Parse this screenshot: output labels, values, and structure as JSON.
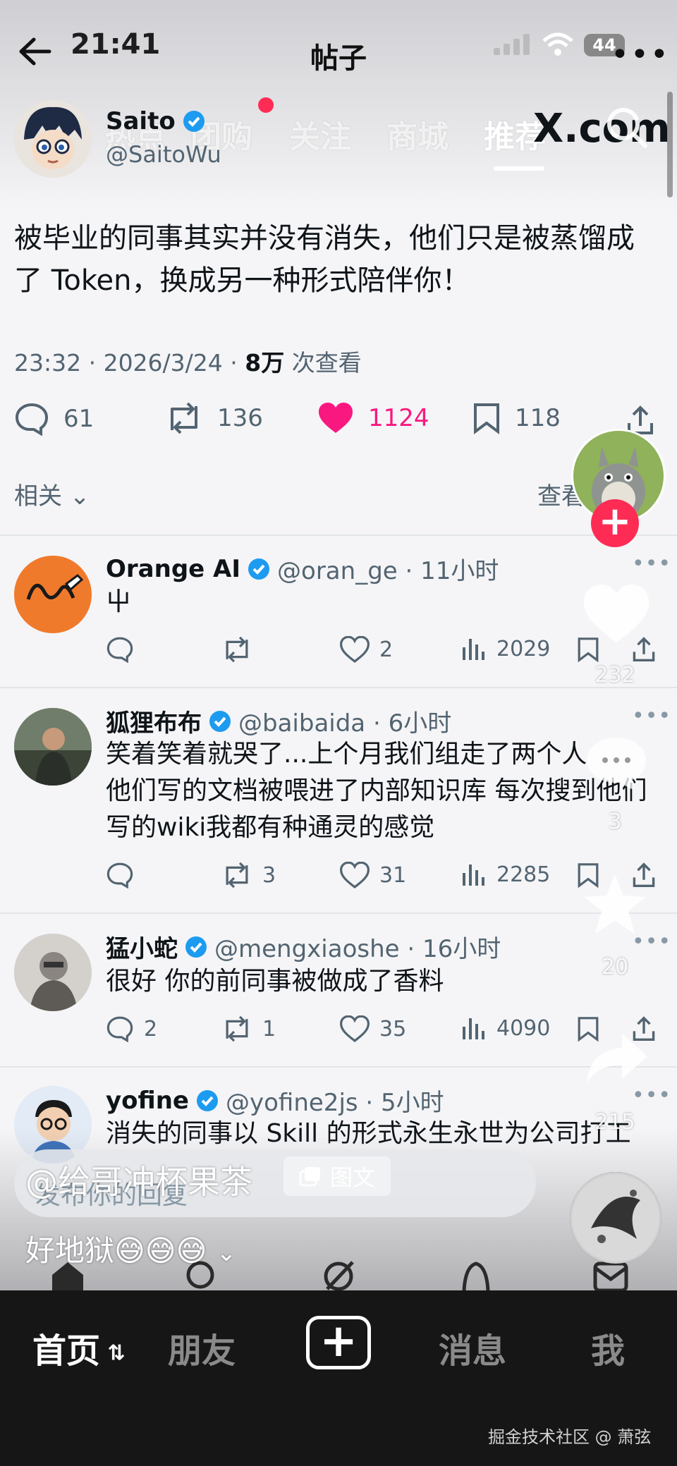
{
  "status_bar": {
    "time": "21:41",
    "title": "帖子",
    "battery": "44"
  },
  "top_tabs": [
    "热点",
    "团购",
    "关注",
    "商城",
    "推荐"
  ],
  "site_label": "X.com",
  "post": {
    "author_name": "Saito",
    "author_handle": "@SaitoWu",
    "text_line1": "被毕业的同事其实并没有消失，他们只是被蒸馏成",
    "text_line2": "了 Token，换成另一种形式陪伴你！",
    "meta_time": "23:32 · 2026/3/24 · ",
    "meta_views": "8万",
    "meta_views_suffix": " 次查看",
    "stats": {
      "replies": "61",
      "reposts": "136",
      "likes": "1124",
      "bookmarks": "118"
    }
  },
  "related": {
    "label": "相关",
    "view_more": "查看"
  },
  "replies": [
    {
      "name": "Orange AI",
      "handle": "@oran_ge · 11小时",
      "lines": [
        "屮"
      ],
      "replies": "",
      "reposts": "",
      "likes": "2",
      "views": "2029"
    },
    {
      "name": "狐狸布布",
      "handle": "@baibaida · 6小时",
      "lines": [
        "笑着笑着就哭了...上个月我们组走了两个人",
        "他们写的文档被喂进了内部知识库 每次搜到他们",
        "写的wiki我都有种通灵的感觉"
      ],
      "replies": "",
      "reposts": "3",
      "likes": "31",
      "views": "2285"
    },
    {
      "name": "猛小蛇",
      "handle": "@mengxiaoshe · 16小时",
      "lines": [
        "很好 你的前同事被做成了香料"
      ],
      "replies": "2",
      "reposts": "1",
      "likes": "35",
      "views": "4090"
    },
    {
      "name": "yofine",
      "handle": "@yofine2js · 5小时",
      "lines": [
        "消失的同事以 Skill 的形式永生永世为公司打工"
      ],
      "replies": "",
      "reposts": "",
      "likes": "",
      "views": ""
    }
  ],
  "side_actions": {
    "likes": "232",
    "comments": "3",
    "favorites": "20",
    "shares": "215"
  },
  "reply_placeholder": "发布你的回复",
  "overlay": {
    "creator": "@给哥冲杯果茶",
    "badge": "图文",
    "caption": "好地狱😅😅😅"
  },
  "bottom_nav": {
    "home": "首页",
    "friends": "朋友",
    "messages": "消息",
    "me": "我"
  },
  "watermark": "掘金技术社区 @ 萧弦",
  "colors": {
    "like_pink": "#f91880",
    "douyin_red": "#fe2c55",
    "verified_blue": "#1d9bf0"
  }
}
